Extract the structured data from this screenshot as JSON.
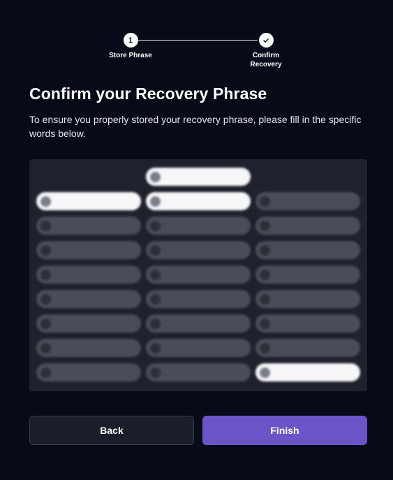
{
  "stepper": {
    "steps": [
      {
        "marker": "1",
        "label": "Store Phrase"
      },
      {
        "marker_icon": "check-icon",
        "label_line1": "Confirm",
        "label_line2": "Recovery"
      }
    ]
  },
  "heading": {
    "title": "Confirm your Recovery Phrase",
    "description": "To ensure you properly stored your recovery phrase, please fill in the specific words below."
  },
  "word_grid": {
    "blurred": true,
    "selected_slot": {
      "num": "",
      "word": ""
    },
    "words": [
      {
        "num": "",
        "word": "",
        "highlighted": true
      },
      {
        "num": "",
        "word": "",
        "highlighted": true
      },
      {
        "num": "",
        "word": "",
        "highlighted": false
      },
      {
        "num": "",
        "word": "",
        "highlighted": false
      },
      {
        "num": "",
        "word": "",
        "highlighted": false
      },
      {
        "num": "",
        "word": "",
        "highlighted": false
      },
      {
        "num": "",
        "word": "",
        "highlighted": false
      },
      {
        "num": "",
        "word": "",
        "highlighted": false
      },
      {
        "num": "",
        "word": "",
        "highlighted": false
      },
      {
        "num": "",
        "word": "",
        "highlighted": false
      },
      {
        "num": "",
        "word": "",
        "highlighted": false
      },
      {
        "num": "",
        "word": "",
        "highlighted": false
      },
      {
        "num": "",
        "word": "",
        "highlighted": false
      },
      {
        "num": "",
        "word": "",
        "highlighted": false
      },
      {
        "num": "",
        "word": "",
        "highlighted": false
      },
      {
        "num": "",
        "word": "",
        "highlighted": false
      },
      {
        "num": "",
        "word": "",
        "highlighted": false
      },
      {
        "num": "",
        "word": "",
        "highlighted": false
      },
      {
        "num": "",
        "word": "",
        "highlighted": false
      },
      {
        "num": "",
        "word": "",
        "highlighted": false
      },
      {
        "num": "",
        "word": "",
        "highlighted": false
      },
      {
        "num": "",
        "word": "",
        "highlighted": false
      },
      {
        "num": "",
        "word": "",
        "highlighted": false
      },
      {
        "num": "",
        "word": "",
        "highlighted": true
      }
    ]
  },
  "buttons": {
    "back_label": "Back",
    "finish_label": "Finish"
  },
  "colors": {
    "background": "#070b18",
    "accent": "#6b54c7",
    "panel": "#1f222c"
  }
}
